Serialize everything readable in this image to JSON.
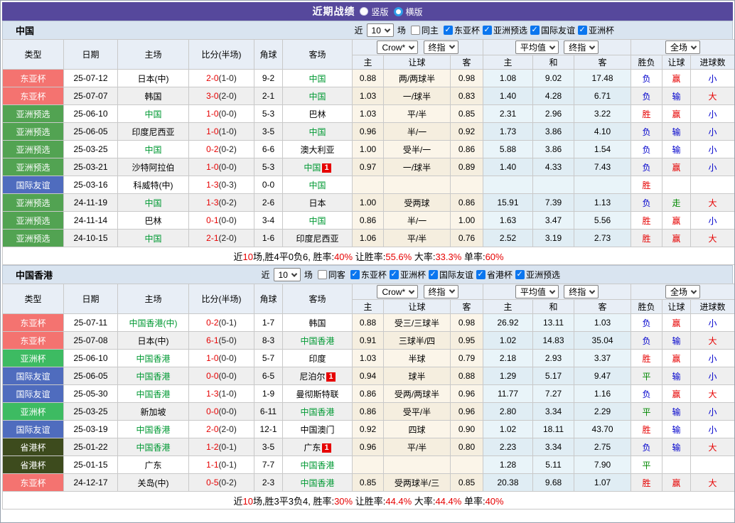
{
  "title_bar": {
    "title": "近期战绩",
    "layout_options": [
      {
        "label": "竖版",
        "selected": false
      },
      {
        "label": "横版",
        "selected": true
      }
    ]
  },
  "columns": {
    "type": "类型",
    "date": "日期",
    "home": "主场",
    "score": "比分(半场)",
    "corner": "角球",
    "away": "客场",
    "odds_home": "主",
    "odds_handicap": "让球",
    "odds_away": "客",
    "avg_home": "主",
    "avg_draw": "和",
    "avg_away": "客",
    "result": "胜负",
    "handicap_result": "让球",
    "goals": "进球数"
  },
  "odds_dropdowns": {
    "bookmaker": "Crow*",
    "bookmaker_stage": "终指",
    "average": "平均值",
    "average_stage": "终指",
    "scope": "全场"
  },
  "colors": {
    "header_purple": "#56489c",
    "accent_red": "#e60000",
    "accent_blue": "#0000cc",
    "accent_green": "#008800",
    "team_green": "#009933",
    "checkbox_blue": "#0b76ef",
    "badge": {
      "东亚杯": "#f47370",
      "亚洲预选": "#52a352",
      "亚洲杯": "#3dbb62",
      "国际友谊": "#4f6cbe",
      "省港杯": "#3d4b1d"
    }
  },
  "sections": [
    {
      "team": "中国",
      "filter": {
        "recent_label": "近",
        "matches_value": "10",
        "matches_label": "场",
        "same_label": "同主",
        "same_checked": false,
        "leagues": [
          "东亚杯",
          "亚洲预选",
          "国际友谊",
          "亚洲杯"
        ]
      },
      "rows": [
        {
          "type": "东亚杯",
          "date": "25-07-12",
          "home": "日本(中)",
          "home_focus": false,
          "score": "2-0",
          "half": "(1-0)",
          "corner": "9-2",
          "away": "中国",
          "away_focus": true,
          "away_rc": "",
          "odds_home": "0.88",
          "handicap": "两/两球半",
          "odds_away": "0.98",
          "avg_home": "1.08",
          "avg_draw": "9.02",
          "avg_away": "17.48",
          "result": "负",
          "handicap_result": "赢",
          "goals": "小"
        },
        {
          "type": "东亚杯",
          "date": "25-07-07",
          "home": "韩国",
          "home_focus": false,
          "score": "3-0",
          "half": "(2-0)",
          "corner": "2-1",
          "away": "中国",
          "away_focus": true,
          "away_rc": "",
          "odds_home": "1.03",
          "handicap": "一/球半",
          "odds_away": "0.83",
          "avg_home": "1.40",
          "avg_draw": "4.28",
          "avg_away": "6.71",
          "result": "负",
          "handicap_result": "输",
          "goals": "大"
        },
        {
          "type": "亚洲预选",
          "date": "25-06-10",
          "home": "中国",
          "home_focus": true,
          "score": "1-0",
          "half": "(0-0)",
          "corner": "5-3",
          "away": "巴林",
          "away_focus": false,
          "away_rc": "",
          "odds_home": "1.03",
          "handicap": "平/半",
          "odds_away": "0.85",
          "avg_home": "2.31",
          "avg_draw": "2.96",
          "avg_away": "3.22",
          "result": "胜",
          "handicap_result": "赢",
          "goals": "小"
        },
        {
          "type": "亚洲预选",
          "date": "25-06-05",
          "home": "印度尼西亚",
          "home_focus": false,
          "score": "1-0",
          "half": "(1-0)",
          "corner": "3-5",
          "away": "中国",
          "away_focus": true,
          "away_rc": "",
          "odds_home": "0.96",
          "handicap": "半/一",
          "odds_away": "0.92",
          "avg_home": "1.73",
          "avg_draw": "3.86",
          "avg_away": "4.10",
          "result": "负",
          "handicap_result": "输",
          "goals": "小"
        },
        {
          "type": "亚洲预选",
          "date": "25-03-25",
          "home": "中国",
          "home_focus": true,
          "score": "0-2",
          "half": "(0-2)",
          "corner": "6-6",
          "away": "澳大利亚",
          "away_focus": false,
          "away_rc": "",
          "odds_home": "1.00",
          "handicap": "受半/一",
          "odds_away": "0.86",
          "avg_home": "5.88",
          "avg_draw": "3.86",
          "avg_away": "1.54",
          "result": "负",
          "handicap_result": "输",
          "goals": "小"
        },
        {
          "type": "亚洲预选",
          "date": "25-03-21",
          "home": "沙特阿拉伯",
          "home_focus": false,
          "score": "1-0",
          "half": "(0-0)",
          "corner": "5-3",
          "away": "中国",
          "away_focus": true,
          "away_rc": "1",
          "odds_home": "0.97",
          "handicap": "一/球半",
          "odds_away": "0.89",
          "avg_home": "1.40",
          "avg_draw": "4.33",
          "avg_away": "7.43",
          "result": "负",
          "handicap_result": "赢",
          "goals": "小"
        },
        {
          "type": "国际友谊",
          "date": "25-03-16",
          "home": "科威特(中)",
          "home_focus": false,
          "score": "1-3",
          "half": "(0-3)",
          "corner": "0-0",
          "away": "中国",
          "away_focus": true,
          "away_rc": "",
          "odds_home": "",
          "handicap": "",
          "odds_away": "",
          "avg_home": "",
          "avg_draw": "",
          "avg_away": "",
          "result": "胜",
          "handicap_result": "",
          "goals": ""
        },
        {
          "type": "亚洲预选",
          "date": "24-11-19",
          "home": "中国",
          "home_focus": true,
          "score": "1-3",
          "half": "(0-2)",
          "corner": "2-6",
          "away": "日本",
          "away_focus": false,
          "away_rc": "",
          "odds_home": "1.00",
          "handicap": "受两球",
          "odds_away": "0.86",
          "avg_home": "15.91",
          "avg_draw": "7.39",
          "avg_away": "1.13",
          "result": "负",
          "handicap_result": "走",
          "goals": "大"
        },
        {
          "type": "亚洲预选",
          "date": "24-11-14",
          "home": "巴林",
          "home_focus": false,
          "score": "0-1",
          "half": "(0-0)",
          "corner": "3-4",
          "away": "中国",
          "away_focus": true,
          "away_rc": "",
          "odds_home": "0.86",
          "handicap": "半/一",
          "odds_away": "1.00",
          "avg_home": "1.63",
          "avg_draw": "3.47",
          "avg_away": "5.56",
          "result": "胜",
          "handicap_result": "赢",
          "goals": "小"
        },
        {
          "type": "亚洲预选",
          "date": "24-10-15",
          "home": "中国",
          "home_focus": true,
          "score": "2-1",
          "half": "(2-0)",
          "corner": "1-6",
          "away": "印度尼西亚",
          "away_focus": false,
          "away_rc": "",
          "odds_home": "1.06",
          "handicap": "平/半",
          "odds_away": "0.76",
          "avg_home": "2.52",
          "avg_draw": "3.19",
          "avg_away": "2.73",
          "result": "胜",
          "handicap_result": "赢",
          "goals": "大"
        }
      ],
      "summary_parts": [
        {
          "text": "近"
        },
        {
          "text": "10",
          "red": true
        },
        {
          "text": "场,胜4平0负6, 胜率:"
        },
        {
          "text": "40%",
          "red": true
        },
        {
          "text": " 让胜率:"
        },
        {
          "text": "55.6%",
          "red": true
        },
        {
          "text": " 大率:"
        },
        {
          "text": "33.3%",
          "red": true
        },
        {
          "text": " 单率:"
        },
        {
          "text": "60%",
          "red": true
        }
      ]
    },
    {
      "team": "中国香港",
      "filter": {
        "recent_label": "近",
        "matches_value": "10",
        "matches_label": "场",
        "same_label": "同客",
        "same_checked": false,
        "leagues": [
          "东亚杯",
          "亚洲杯",
          "国际友谊",
          "省港杯",
          "亚洲预选"
        ]
      },
      "rows": [
        {
          "type": "东亚杯",
          "date": "25-07-11",
          "home": "中国香港(中)",
          "home_focus": true,
          "score": "0-2",
          "half": "(0-1)",
          "corner": "1-7",
          "away": "韩国",
          "away_focus": false,
          "away_rc": "",
          "odds_home": "0.88",
          "handicap": "受三/三球半",
          "odds_away": "0.98",
          "avg_home": "26.92",
          "avg_draw": "13.11",
          "avg_away": "1.03",
          "result": "负",
          "handicap_result": "赢",
          "goals": "小"
        },
        {
          "type": "东亚杯",
          "date": "25-07-08",
          "home": "日本(中)",
          "home_focus": false,
          "score": "6-1",
          "half": "(5-0)",
          "corner": "8-3",
          "away": "中国香港",
          "away_focus": true,
          "away_rc": "",
          "odds_home": "0.91",
          "handicap": "三球半/四",
          "odds_away": "0.95",
          "avg_home": "1.02",
          "avg_draw": "14.83",
          "avg_away": "35.04",
          "result": "负",
          "handicap_result": "输",
          "goals": "大"
        },
        {
          "type": "亚洲杯",
          "date": "25-06-10",
          "home": "中国香港",
          "home_focus": true,
          "score": "1-0",
          "half": "(0-0)",
          "corner": "5-7",
          "away": "印度",
          "away_focus": false,
          "away_rc": "",
          "odds_home": "1.03",
          "handicap": "半球",
          "odds_away": "0.79",
          "avg_home": "2.18",
          "avg_draw": "2.93",
          "avg_away": "3.37",
          "result": "胜",
          "handicap_result": "赢",
          "goals": "小"
        },
        {
          "type": "国际友谊",
          "date": "25-06-05",
          "home": "中国香港",
          "home_focus": true,
          "score": "0-0",
          "half": "(0-0)",
          "corner": "6-5",
          "away": "尼泊尔",
          "away_focus": false,
          "away_rc": "1",
          "odds_home": "0.94",
          "handicap": "球半",
          "odds_away": "0.88",
          "avg_home": "1.29",
          "avg_draw": "5.17",
          "avg_away": "9.47",
          "result": "平",
          "handicap_result": "输",
          "goals": "小"
        },
        {
          "type": "国际友谊",
          "date": "25-05-30",
          "home": "中国香港",
          "home_focus": true,
          "score": "1-3",
          "half": "(1-0)",
          "corner": "1-9",
          "away": "曼彻斯特联",
          "away_focus": false,
          "away_rc": "",
          "odds_home": "0.86",
          "handicap": "受两/两球半",
          "odds_away": "0.96",
          "avg_home": "11.77",
          "avg_draw": "7.27",
          "avg_away": "1.16",
          "result": "负",
          "handicap_result": "赢",
          "goals": "大"
        },
        {
          "type": "亚洲杯",
          "date": "25-03-25",
          "home": "新加坡",
          "home_focus": false,
          "score": "0-0",
          "half": "(0-0)",
          "corner": "6-11",
          "away": "中国香港",
          "away_focus": true,
          "away_rc": "",
          "odds_home": "0.86",
          "handicap": "受平/半",
          "odds_away": "0.96",
          "avg_home": "2.80",
          "avg_draw": "3.34",
          "avg_away": "2.29",
          "result": "平",
          "handicap_result": "输",
          "goals": "小"
        },
        {
          "type": "国际友谊",
          "date": "25-03-19",
          "home": "中国香港",
          "home_focus": true,
          "score": "2-0",
          "half": "(2-0)",
          "corner": "12-1",
          "away": "中国澳门",
          "away_focus": false,
          "away_rc": "",
          "odds_home": "0.92",
          "handicap": "四球",
          "odds_away": "0.90",
          "avg_home": "1.02",
          "avg_draw": "18.11",
          "avg_away": "43.70",
          "result": "胜",
          "handicap_result": "输",
          "goals": "小"
        },
        {
          "type": "省港杯",
          "date": "25-01-22",
          "home": "中国香港",
          "home_focus": true,
          "score": "1-2",
          "half": "(0-1)",
          "corner": "3-5",
          "away": "广东",
          "away_focus": false,
          "away_rc": "1",
          "odds_home": "0.96",
          "handicap": "平/半",
          "odds_away": "0.80",
          "avg_home": "2.23",
          "avg_draw": "3.34",
          "avg_away": "2.75",
          "result": "负",
          "handicap_result": "输",
          "goals": "大"
        },
        {
          "type": "省港杯",
          "date": "25-01-15",
          "home": "广东",
          "home_focus": false,
          "score": "1-1",
          "half": "(0-1)",
          "corner": "7-7",
          "away": "中国香港",
          "away_focus": true,
          "away_rc": "",
          "odds_home": "",
          "handicap": "",
          "odds_away": "",
          "avg_home": "1.28",
          "avg_draw": "5.11",
          "avg_away": "7.90",
          "result": "平",
          "handicap_result": "",
          "goals": ""
        },
        {
          "type": "东亚杯",
          "date": "24-12-17",
          "home": "关岛(中)",
          "home_focus": false,
          "score": "0-5",
          "half": "(0-2)",
          "corner": "2-3",
          "away": "中国香港",
          "away_focus": true,
          "away_rc": "",
          "odds_home": "0.85",
          "handicap": "受两球半/三",
          "odds_away": "0.85",
          "avg_home": "20.38",
          "avg_draw": "9.68",
          "avg_away": "1.07",
          "result": "胜",
          "handicap_result": "赢",
          "goals": "大"
        }
      ],
      "summary_parts": [
        {
          "text": "近"
        },
        {
          "text": "10",
          "red": true
        },
        {
          "text": "场,胜3平3负4, 胜率:"
        },
        {
          "text": "30%",
          "red": true
        },
        {
          "text": " 让胜率:"
        },
        {
          "text": "44.4%",
          "red": true
        },
        {
          "text": " 大率:"
        },
        {
          "text": "44.4%",
          "red": true
        },
        {
          "text": " 单率:"
        },
        {
          "text": "40%",
          "red": true
        }
      ]
    }
  ]
}
